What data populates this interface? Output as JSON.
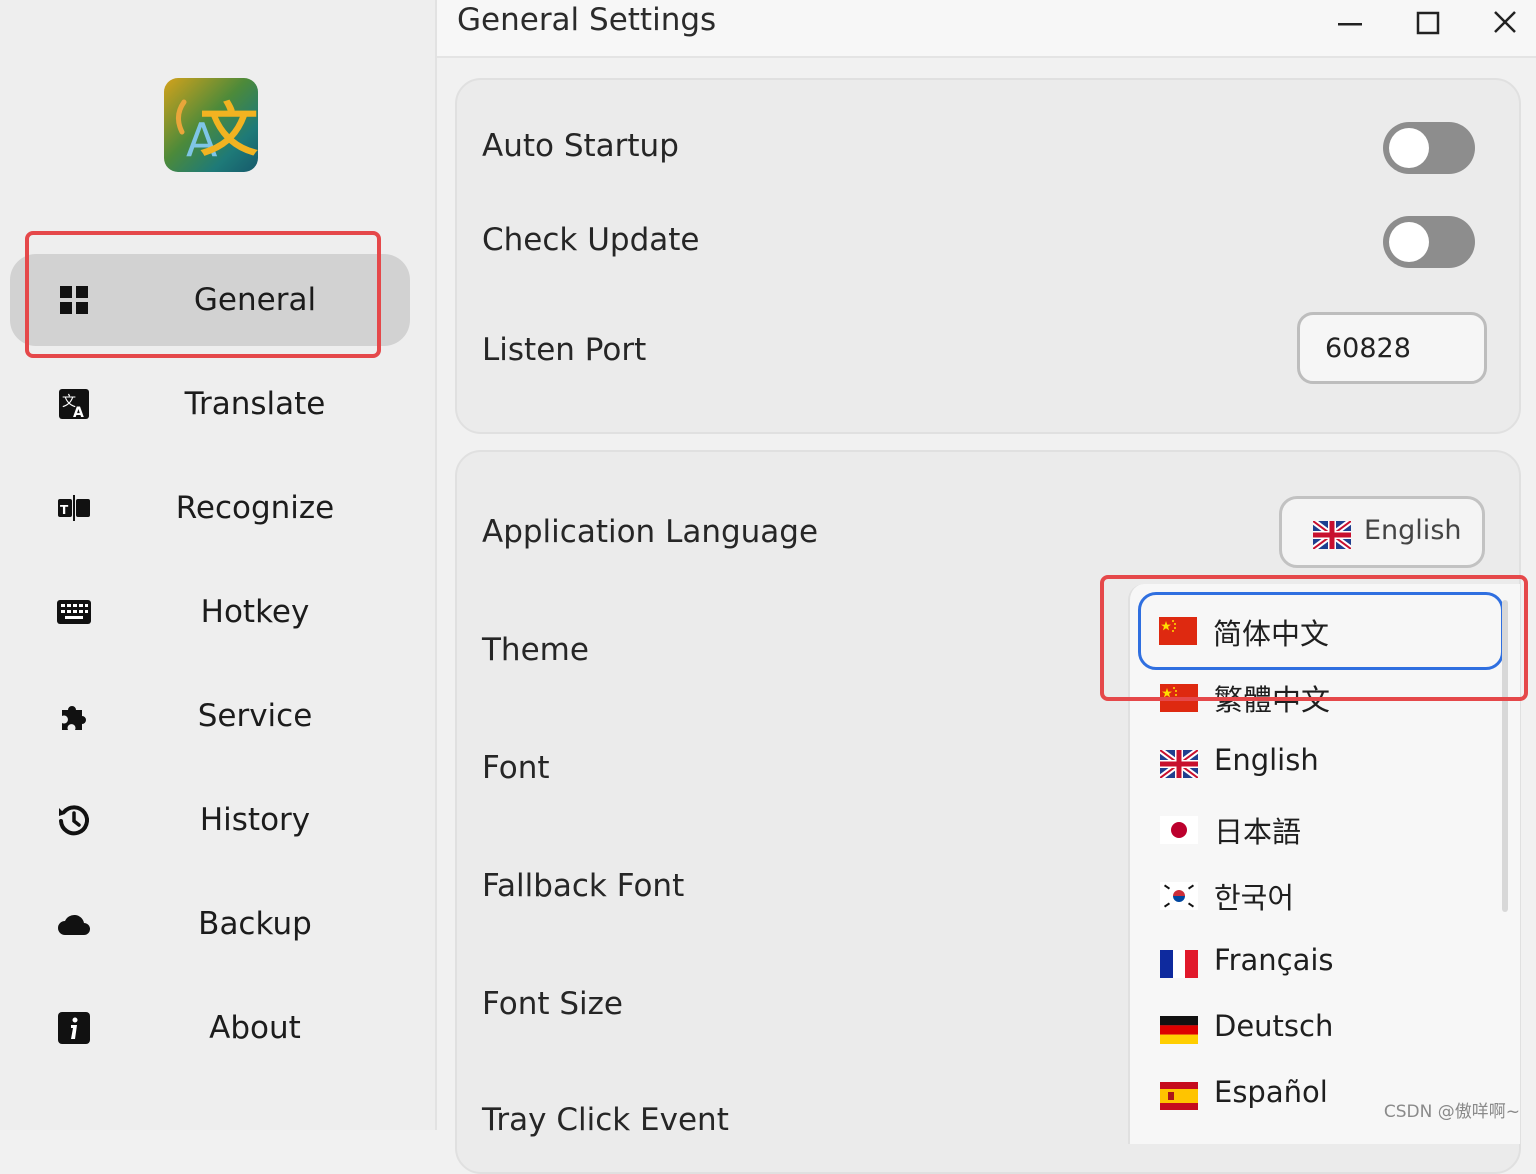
{
  "window": {
    "title": "General Settings"
  },
  "sidebar": {
    "logo_icon": "translate-app-logo",
    "items": [
      {
        "label": "General",
        "icon": "grid-icon",
        "active": true
      },
      {
        "label": "Translate",
        "icon": "translate-icon",
        "active": false
      },
      {
        "label": "Recognize",
        "icon": "ocr-icon",
        "active": false
      },
      {
        "label": "Hotkey",
        "icon": "keyboard-icon",
        "active": false
      },
      {
        "label": "Service",
        "icon": "puzzle-icon",
        "active": false
      },
      {
        "label": "History",
        "icon": "history-icon",
        "active": false
      },
      {
        "label": "Backup",
        "icon": "cloud-icon",
        "active": false
      },
      {
        "label": "About",
        "icon": "info-icon",
        "active": false
      }
    ]
  },
  "settings": {
    "auto_startup": {
      "label": "Auto Startup",
      "enabled": false
    },
    "check_update": {
      "label": "Check Update",
      "enabled": false
    },
    "listen_port": {
      "label": "Listen Port",
      "value": "60828"
    },
    "application_language": {
      "label": "Application Language",
      "selected": "English",
      "selected_flag": "uk-flag"
    },
    "theme": {
      "label": "Theme"
    },
    "font": {
      "label": "Font"
    },
    "fallback_font": {
      "label": "Fallback Font"
    },
    "font_size": {
      "label": "Font Size"
    },
    "tray_click_event": {
      "label": "Tray Click Event"
    }
  },
  "language_dropdown": {
    "options": [
      {
        "label": "简体中文",
        "flag": "china-flag",
        "highlighted": true
      },
      {
        "label": "繁體中文",
        "flag": "china-flag",
        "highlighted": false
      },
      {
        "label": "English",
        "flag": "uk-flag",
        "highlighted": false
      },
      {
        "label": "日本語",
        "flag": "japan-flag",
        "highlighted": false
      },
      {
        "label": "한국어",
        "flag": "korea-flag",
        "highlighted": false
      },
      {
        "label": "Français",
        "flag": "france-flag",
        "highlighted": false
      },
      {
        "label": "Deutsch",
        "flag": "germany-flag",
        "highlighted": false
      },
      {
        "label": "Español",
        "flag": "spain-flag",
        "highlighted": false
      }
    ]
  },
  "colors": {
    "highlight_red": "#e5484a",
    "focus_blue": "#2f6fe0",
    "toggle_off": "#8d8d8d",
    "active_nav": "#d2d2d2"
  },
  "watermark": "CSDN @傲咩啊~"
}
